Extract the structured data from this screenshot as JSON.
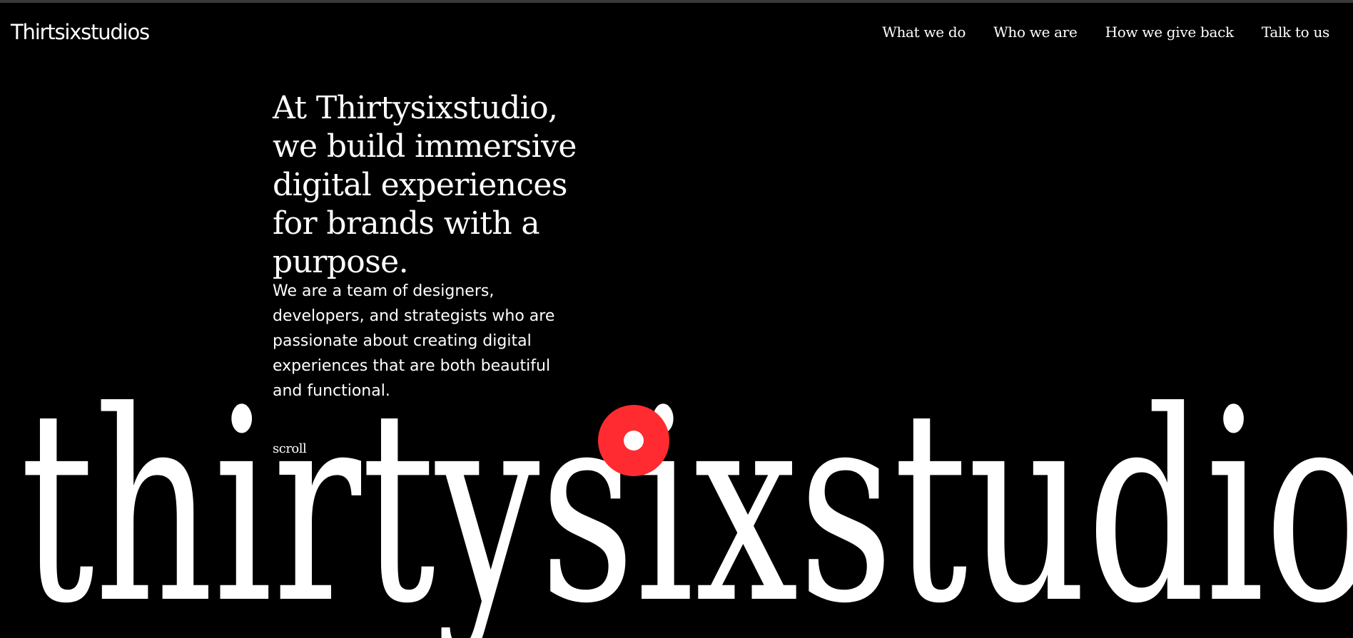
{
  "header": {
    "logo": "Thirtsixstudios",
    "nav": [
      {
        "label": "What we do"
      },
      {
        "label": "Who we are"
      },
      {
        "label": "How we give back"
      },
      {
        "label": "Talk to us"
      }
    ]
  },
  "hero": {
    "headline": "At Thirtysixstudio, we build immersive digital experiences for brands with a purpose.",
    "intro": "We are a team of designers, developers, and strategists who are passionate about creating digital experiences that are both beautiful and functional.",
    "scroll_label": "scroll",
    "wordmark": "thirtysixstudio"
  },
  "colors": {
    "background": "#000000",
    "text": "#ffffff",
    "accent": "#ff2b30"
  }
}
